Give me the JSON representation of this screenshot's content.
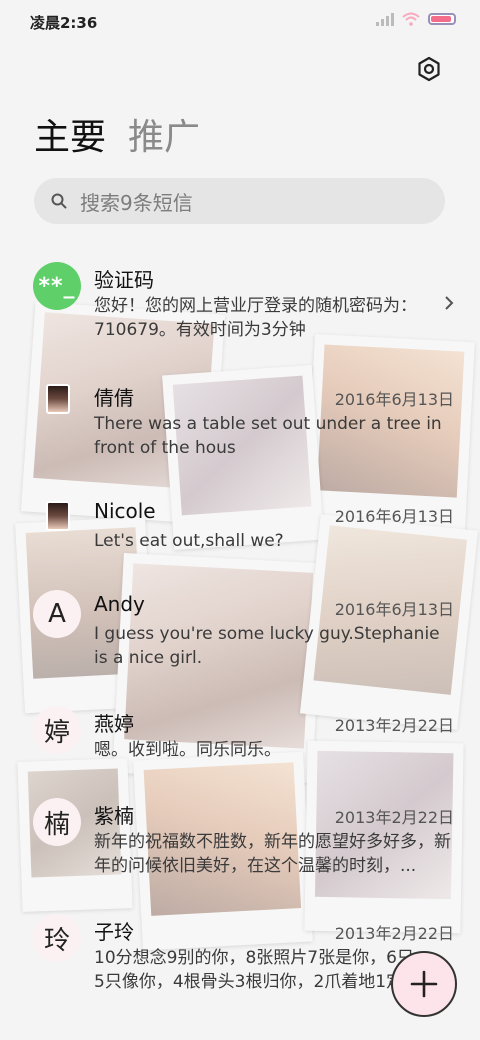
{
  "status_bar": {
    "time": "凌晨2:36"
  },
  "tabs": {
    "primary": "主要",
    "promotions": "推广"
  },
  "search": {
    "placeholder": "搜索9条短信"
  },
  "icons": {
    "settings": "gear-icon",
    "search": "search-icon",
    "chevron": "chevron-right-icon",
    "fab": "plus-icon"
  },
  "colors": {
    "code_avatar": "#5fcf6a",
    "avatar_bg": "#fbf1f3",
    "fab_bg": "#fde3ea",
    "battery": "#f46b8b"
  },
  "messages": [
    {
      "avatar": "**_",
      "name": "验证码",
      "date": "",
      "preview": "您好！您的网上营业厅登录的随机密码为：710679。有效时间为3分钟"
    },
    {
      "avatar": "",
      "name": "倩倩",
      "date": "2016年6月13日",
      "preview": "There was a table set out under a tree in front of the hous"
    },
    {
      "avatar": "",
      "name": "Nicole",
      "date": "2016年6月13日",
      "preview": "Let's eat out,shall we?"
    },
    {
      "avatar": "A",
      "name": "Andy",
      "date": "2016年6月13日",
      "preview": "I guess you're some lucky guy.Stephanie is a nice girl."
    },
    {
      "avatar": "婷",
      "name": "燕婷",
      "date": "2013年2月22日",
      "preview": "嗯。收到啦。同乐同乐。"
    },
    {
      "avatar": "楠",
      "name": "紫楠",
      "date": "2013年2月22日",
      "preview": "新年的祝福数不胜数，新年的愿望好多好多，新年的问候依旧美好，在这个温馨的时刻，..."
    },
    {
      "avatar": "玲",
      "name": "子玲",
      "date": "2013年2月22日",
      "preview": "10分想念9别的你，8张照片7张是你，6只……5只像你，4根骨头3根归你，2爪着地1定是你"
    }
  ]
}
